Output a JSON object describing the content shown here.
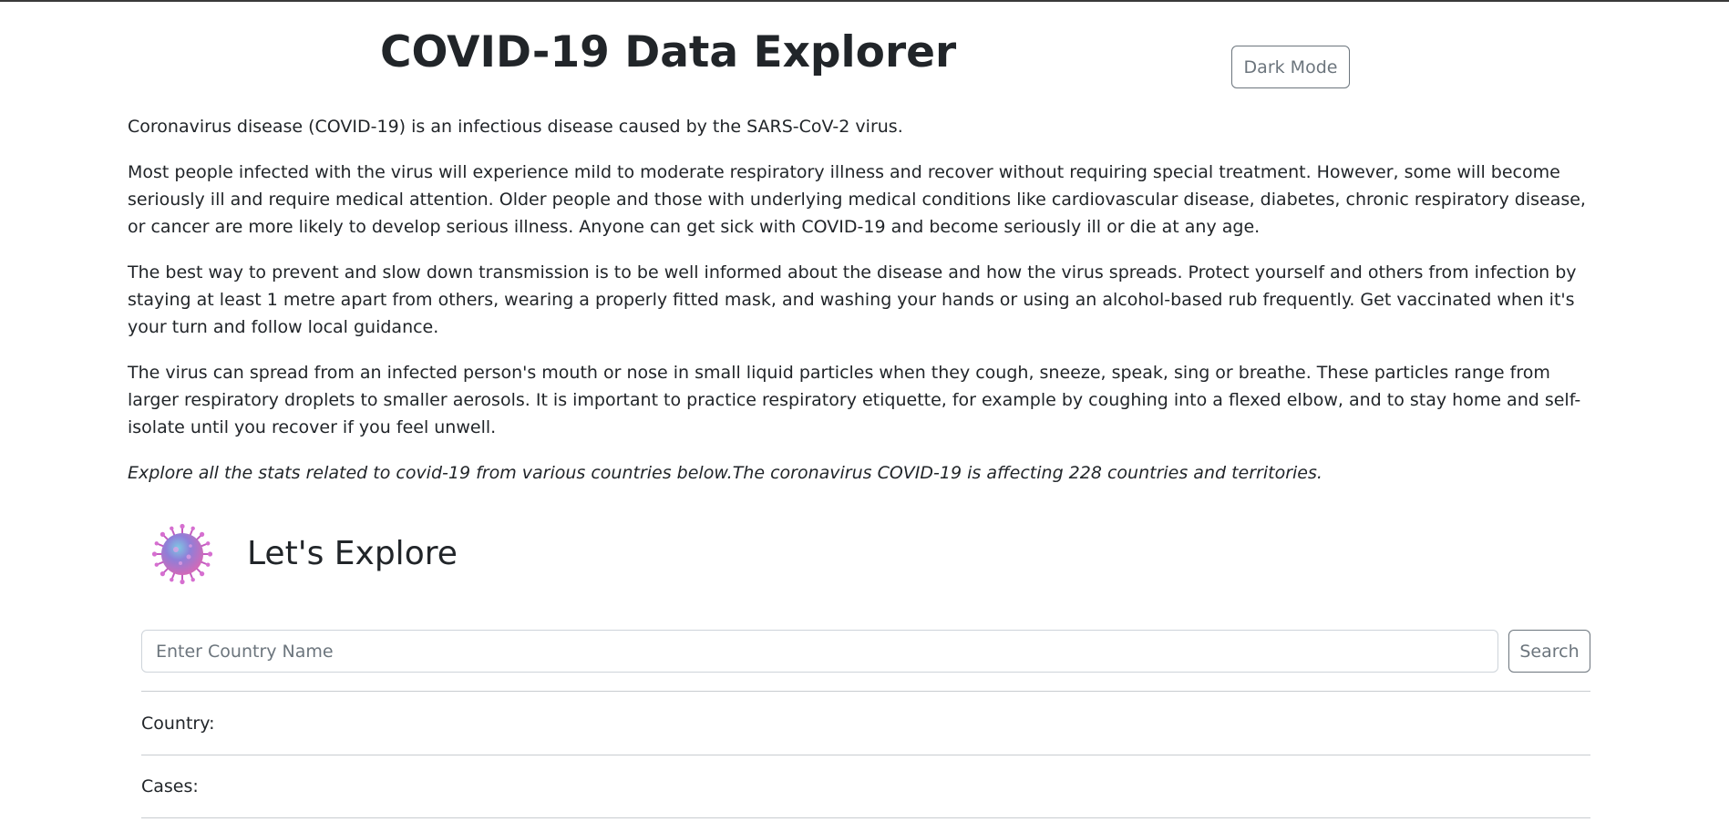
{
  "header": {
    "title": "COVID-19 Data Explorer",
    "dark_mode_label": "Dark Mode"
  },
  "intro": {
    "paragraphs": [
      "Coronavirus disease (COVID-19) is an infectious disease caused by the SARS-CoV-2 virus.",
      "Most people infected with the virus will experience mild to moderate respiratory illness and recover without requiring special treatment. However, some will become seriously ill and require medical attention. Older people and those with underlying medical conditions like cardiovascular disease, diabetes, chronic respiratory disease, or cancer are more likely to develop serious illness. Anyone can get sick with COVID-19 and become seriously ill or die at any age.",
      "The best way to prevent and slow down transmission is to be well informed about the disease and how the virus spreads. Protect yourself and others from infection by staying at least 1 metre apart from others, wearing a properly fitted mask, and washing your hands or using an alcohol-based rub frequently. Get vaccinated when it's your turn and follow local guidance.",
      "The virus can spread from an infected person's mouth or nose in small liquid particles when they cough, sneeze, speak, sing or breathe. These particles range from larger respiratory droplets to smaller aerosols. It is important to practice respiratory etiquette, for example by coughing into a flexed elbow, and to stay home and self-isolate until you recover if you feel unwell."
    ],
    "tagline": "Explore all the stats related to covid-19 from various countries below.The coronavirus COVID-19 is affecting 228 countries and territories."
  },
  "explore": {
    "icon": "virus-icon",
    "title": "Let's Explore"
  },
  "search": {
    "placeholder": "Enter Country Name",
    "value": "",
    "button_label": "Search"
  },
  "stats": {
    "country_label": "Country:",
    "country_value": "",
    "cases_label": "Cases:",
    "cases_value": ""
  },
  "colors": {
    "text": "#212529",
    "secondary": "#6c757d",
    "border": "#ced4da"
  }
}
